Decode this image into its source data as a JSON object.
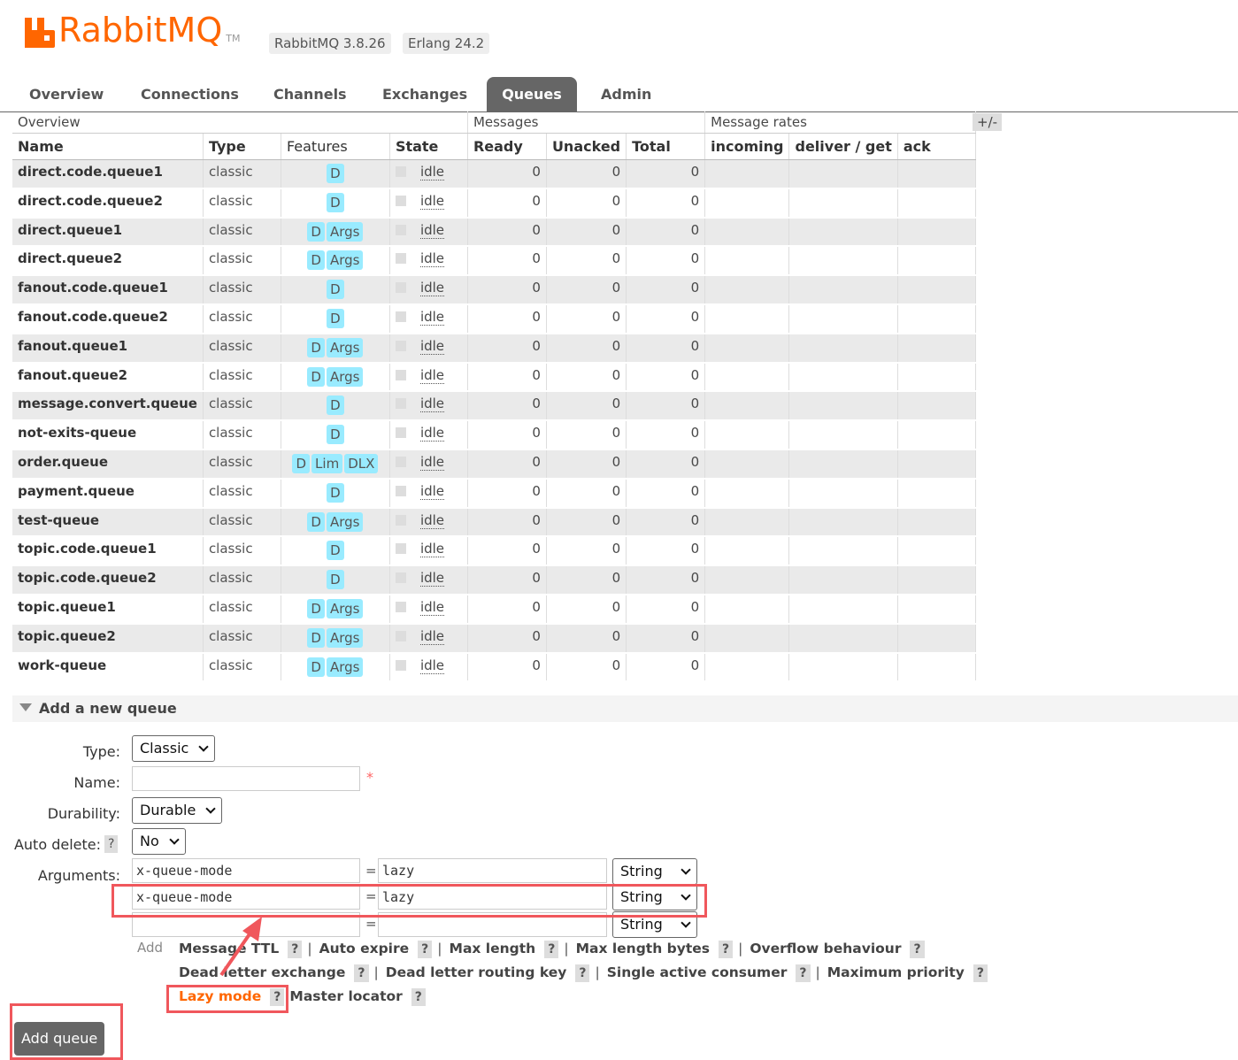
{
  "header": {
    "logo_text": "RabbitMQ",
    "logo_tm": "TM",
    "version_rabbit": "RabbitMQ 3.8.26",
    "version_erlang": "Erlang 24.2"
  },
  "tabs": [
    "Overview",
    "Connections",
    "Channels",
    "Exchanges",
    "Queues",
    "Admin"
  ],
  "active_tab": "Queues",
  "table": {
    "group_headers": {
      "overview": "Overview",
      "messages": "Messages",
      "rates": "Message rates",
      "toggle": "+/-"
    },
    "columns": [
      "Name",
      "Type",
      "Features",
      "State",
      "Ready",
      "Unacked",
      "Total",
      "incoming",
      "deliver / get",
      "ack"
    ],
    "rows": [
      {
        "name": "direct.code.queue1",
        "type": "classic",
        "features": [
          "D"
        ],
        "state": "idle",
        "ready": "0",
        "unacked": "0",
        "total": "0"
      },
      {
        "name": "direct.code.queue2",
        "type": "classic",
        "features": [
          "D"
        ],
        "state": "idle",
        "ready": "0",
        "unacked": "0",
        "total": "0"
      },
      {
        "name": "direct.queue1",
        "type": "classic",
        "features": [
          "D",
          "Args"
        ],
        "state": "idle",
        "ready": "0",
        "unacked": "0",
        "total": "0"
      },
      {
        "name": "direct.queue2",
        "type": "classic",
        "features": [
          "D",
          "Args"
        ],
        "state": "idle",
        "ready": "0",
        "unacked": "0",
        "total": "0"
      },
      {
        "name": "fanout.code.queue1",
        "type": "classic",
        "features": [
          "D"
        ],
        "state": "idle",
        "ready": "0",
        "unacked": "0",
        "total": "0"
      },
      {
        "name": "fanout.code.queue2",
        "type": "classic",
        "features": [
          "D"
        ],
        "state": "idle",
        "ready": "0",
        "unacked": "0",
        "total": "0"
      },
      {
        "name": "fanout.queue1",
        "type": "classic",
        "features": [
          "D",
          "Args"
        ],
        "state": "idle",
        "ready": "0",
        "unacked": "0",
        "total": "0"
      },
      {
        "name": "fanout.queue2",
        "type": "classic",
        "features": [
          "D",
          "Args"
        ],
        "state": "idle",
        "ready": "0",
        "unacked": "0",
        "total": "0"
      },
      {
        "name": "message.convert.queue",
        "type": "classic",
        "features": [
          "D"
        ],
        "state": "idle",
        "ready": "0",
        "unacked": "0",
        "total": "0"
      },
      {
        "name": "not-exits-queue",
        "type": "classic",
        "features": [
          "D"
        ],
        "state": "idle",
        "ready": "0",
        "unacked": "0",
        "total": "0"
      },
      {
        "name": "order.queue",
        "type": "classic",
        "features": [
          "D",
          "Lim",
          "DLX"
        ],
        "state": "idle",
        "ready": "0",
        "unacked": "0",
        "total": "0"
      },
      {
        "name": "payment.queue",
        "type": "classic",
        "features": [
          "D"
        ],
        "state": "idle",
        "ready": "0",
        "unacked": "0",
        "total": "0"
      },
      {
        "name": "test-queue",
        "type": "classic",
        "features": [
          "D",
          "Args"
        ],
        "state": "idle",
        "ready": "0",
        "unacked": "0",
        "total": "0"
      },
      {
        "name": "topic.code.queue1",
        "type": "classic",
        "features": [
          "D"
        ],
        "state": "idle",
        "ready": "0",
        "unacked": "0",
        "total": "0"
      },
      {
        "name": "topic.code.queue2",
        "type": "classic",
        "features": [
          "D"
        ],
        "state": "idle",
        "ready": "0",
        "unacked": "0",
        "total": "0"
      },
      {
        "name": "topic.queue1",
        "type": "classic",
        "features": [
          "D",
          "Args"
        ],
        "state": "idle",
        "ready": "0",
        "unacked": "0",
        "total": "0"
      },
      {
        "name": "topic.queue2",
        "type": "classic",
        "features": [
          "D",
          "Args"
        ],
        "state": "idle",
        "ready": "0",
        "unacked": "0",
        "total": "0"
      },
      {
        "name": "work-queue",
        "type": "classic",
        "features": [
          "D",
          "Args"
        ],
        "state": "idle",
        "ready": "0",
        "unacked": "0",
        "total": "0"
      }
    ]
  },
  "add_queue": {
    "section_title": "Add a new queue",
    "type_label": "Type:",
    "type_value": "Classic",
    "name_label": "Name:",
    "name_value": "",
    "required_mark": "*",
    "durability_label": "Durability:",
    "durability_value": "Durable",
    "auto_delete_label": "Auto delete:",
    "auto_delete_value": "No",
    "arguments_label": "Arguments:",
    "arguments": [
      {
        "key": "x-queue-mode",
        "value": "lazy",
        "type": "String"
      },
      {
        "key": "x-queue-mode",
        "value": "lazy",
        "type": "String"
      },
      {
        "key": "",
        "value": "",
        "type": "String"
      }
    ],
    "equals": "=",
    "help": "?",
    "add_label": "Add",
    "shortcuts_line1": [
      "Message TTL",
      "Auto expire",
      "Max length",
      "Max length bytes",
      "Overflow behaviour"
    ],
    "shortcuts_line2": [
      "Dead letter exchange",
      "Dead letter routing key",
      "Single active consumer",
      "Maximum priority"
    ],
    "shortcuts_line3": [
      "Lazy mode",
      "Master locator"
    ],
    "separator": "|",
    "submit_label": "Add queue"
  },
  "colors": {
    "brand": "#ff6600",
    "badge": "#99ebff",
    "annotation": "#f0575c"
  }
}
